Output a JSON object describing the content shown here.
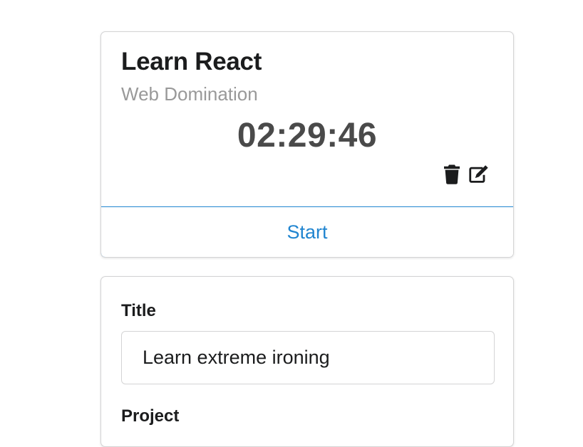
{
  "timer": {
    "title": "Learn React",
    "project": "Web Domination",
    "elapsed": "02:29:46",
    "start_label": "Start",
    "icons": {
      "delete": "trash-icon",
      "edit": "edit-icon"
    }
  },
  "form": {
    "title_label": "Title",
    "title_value": "Learn extreme ironing",
    "project_label": "Project"
  },
  "colors": {
    "accent": "#2185d0",
    "meta": "#999999",
    "border": "#d4d4d5"
  }
}
